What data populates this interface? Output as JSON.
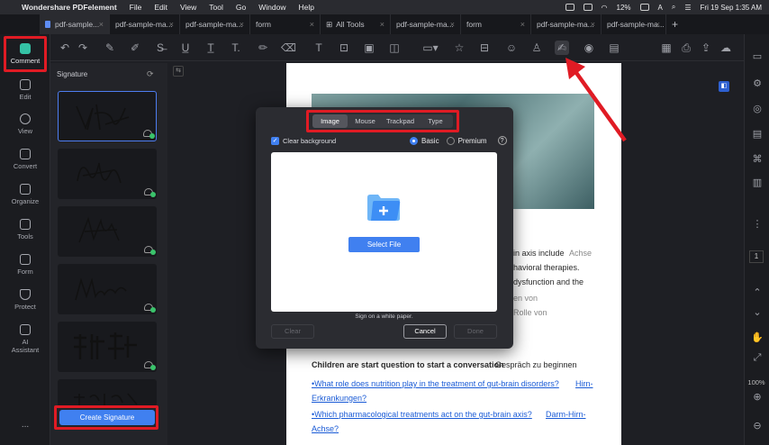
{
  "menubar": {
    "apple": "",
    "app_name": "Wondershare PDFelement",
    "items": [
      "File",
      "Edit",
      "View",
      "Tool",
      "Go",
      "Window",
      "Help"
    ],
    "battery": "12%",
    "datetime": "Fri 19 Sep  1:35 AM",
    "input_source": "A"
  },
  "tabs": [
    {
      "label": "pdf-sample..."
    },
    {
      "label": "pdf-sample-ma..."
    },
    {
      "label": "pdf-sample-ma..."
    },
    {
      "label": "form"
    },
    {
      "label": "All Tools"
    },
    {
      "label": "pdf-sample-ma..."
    },
    {
      "label": "form"
    },
    {
      "label": "pdf-sample-ma..."
    },
    {
      "label": "pdf-sample-ma..."
    }
  ],
  "new_tab": "+",
  "left_rail": [
    {
      "label": "Comment",
      "icon": "comment-icon",
      "active": true
    },
    {
      "label": "Edit",
      "icon": "edit-icon"
    },
    {
      "label": "View",
      "icon": "eye-icon"
    },
    {
      "label": "Convert",
      "icon": "convert-icon"
    },
    {
      "label": "Organize",
      "icon": "organize-icon"
    },
    {
      "label": "Tools",
      "icon": "tools-icon"
    },
    {
      "label": "Form",
      "icon": "form-icon"
    },
    {
      "label": "Protect",
      "icon": "shield-icon"
    },
    {
      "label": "AI\nAssistant",
      "icon": "ai-icon"
    }
  ],
  "more": "...",
  "signature_panel": {
    "title": "Signature",
    "create_button": "Create Signature",
    "thumbnail_count": 6
  },
  "dialog": {
    "tabs": [
      "Image",
      "Mouse",
      "Trackpad",
      "Type"
    ],
    "active_tab": "Image",
    "clear_background": "Clear background",
    "mode_basic": "Basic",
    "mode_premium": "Premium",
    "select_file": "Select File",
    "hint": "Sign on a white paper.",
    "clear": "Clear",
    "cancel": "Cancel",
    "done": "Done"
  },
  "document": {
    "behind_dialog_1": "in axis include",
    "behind_dialog_2": "havioral therapies.",
    "behind_dialog_3": "dysfunction and the",
    "behind_dialog_4": "Achse",
    "behind_dialog_5": "en von",
    "behind_dialog_6": "Rolle von",
    "question_header": "Children are start question to start a conversation",
    "question_header_de": "Gespräch zu beginnen",
    "q1": "•What role does nutrition play in the treatment of gut-brain disorders?",
    "q1_de": "Hirn-",
    "q1_cont": "Erkrankungen?",
    "q2": "•Which pharmacological treatments act on the gut-brain axis?",
    "q2_de": "Darm-Hirn-",
    "q2_cont": "Achse?"
  },
  "right_rail": {
    "page": "1",
    "zoom": "100%"
  }
}
